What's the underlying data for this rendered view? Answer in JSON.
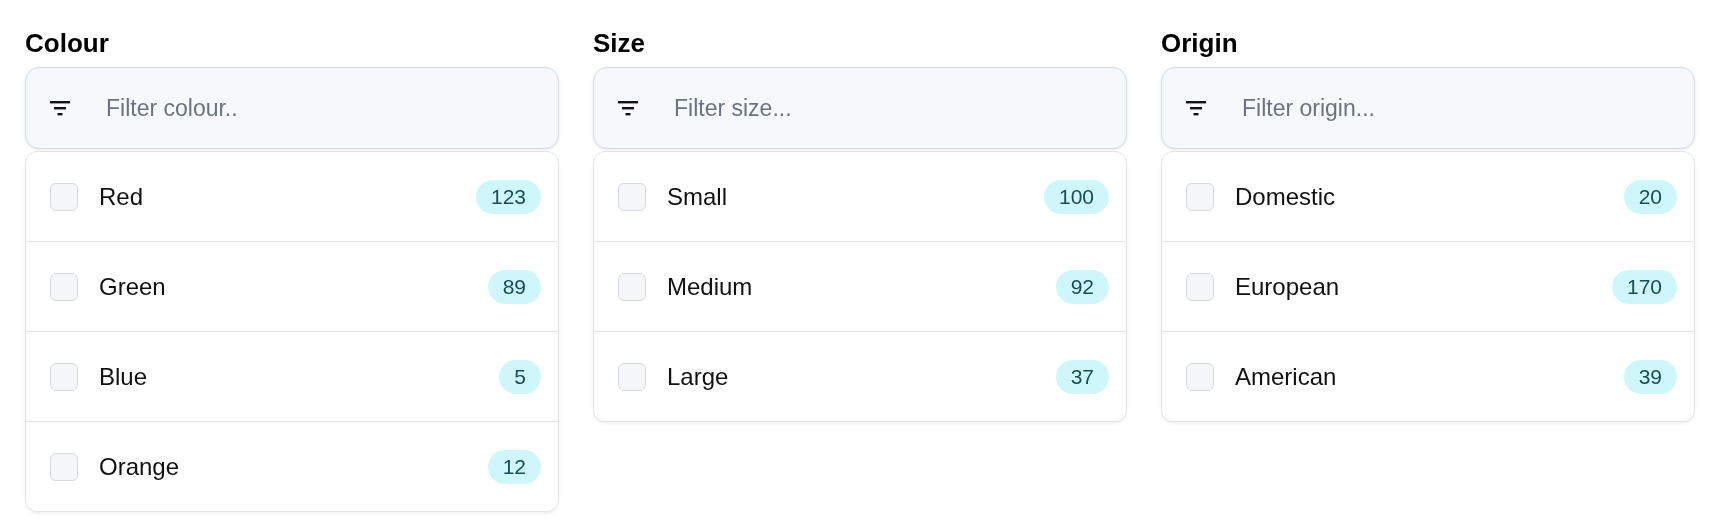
{
  "groups": [
    {
      "title": "Colour",
      "filter": {
        "placeholder": "Filter colour.."
      },
      "options": [
        {
          "label": "Red",
          "count": "123",
          "checked": false
        },
        {
          "label": "Green",
          "count": "89",
          "checked": false
        },
        {
          "label": "Blue",
          "count": "5",
          "checked": false
        },
        {
          "label": "Orange",
          "count": "12",
          "checked": false
        }
      ]
    },
    {
      "title": "Size",
      "filter": {
        "placeholder": "Filter size..."
      },
      "options": [
        {
          "label": "Small",
          "count": "100",
          "checked": false
        },
        {
          "label": "Medium",
          "count": "92",
          "checked": false
        },
        {
          "label": "Large",
          "count": "37",
          "checked": false
        }
      ]
    },
    {
      "title": "Origin",
      "filter": {
        "placeholder": "Filter origin..."
      },
      "options": [
        {
          "label": "Domestic",
          "count": "20",
          "checked": false
        },
        {
          "label": "European",
          "count": "170",
          "checked": false
        },
        {
          "label": "American",
          "count": "39",
          "checked": false
        }
      ]
    }
  ]
}
